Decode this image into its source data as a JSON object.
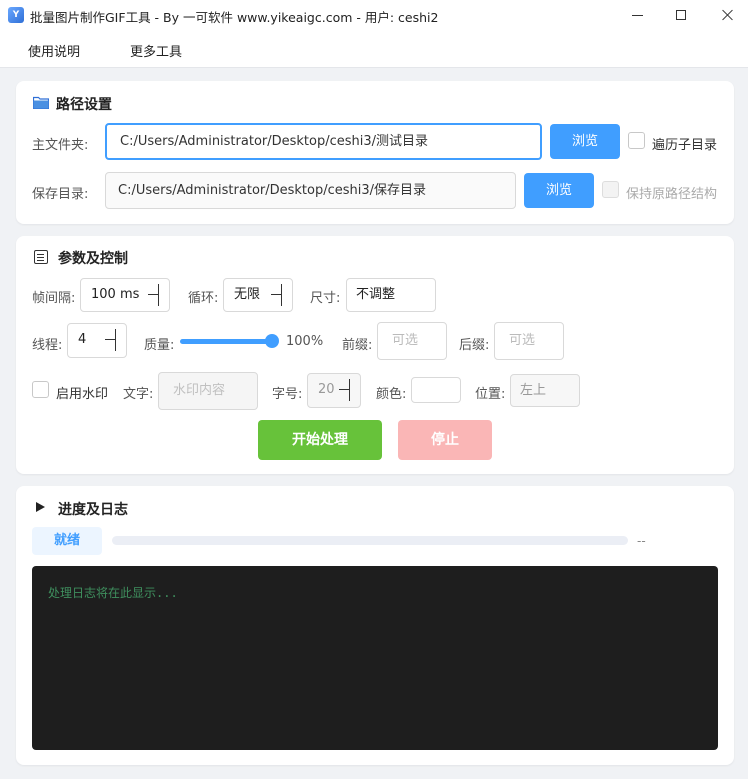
{
  "window": {
    "title": "批量图片制作GIF工具 - By 一可软件 www.yikeaigc.com - 用户: ceshi2",
    "app_icon_text": "Y"
  },
  "menu": {
    "items": [
      "使用说明",
      "更多工具"
    ]
  },
  "path_section": {
    "title": "路径设置",
    "main_folder_label": "主文件夹:",
    "main_folder_value": "C:/Users/Administrator/Desktop/ceshi3/测试目录",
    "browse_label": "浏览",
    "traverse_subdirs_label": "遍历子目录",
    "save_dir_label": "保存目录:",
    "save_dir_value": "C:/Users/Administrator/Desktop/ceshi3/保存目录",
    "browse2_label": "浏览",
    "keep_structure_label": "保持原路径结构"
  },
  "param_section": {
    "title": "参数及控制",
    "frame_interval_label": "帧间隔:",
    "frame_interval_value": "100 ms",
    "loop_label": "循环:",
    "loop_value": "无限",
    "size_label": "尺寸:",
    "size_value": "不调整",
    "threads_label": "线程:",
    "threads_value": "4",
    "quality_label": "质量:",
    "quality_value": "100%",
    "quality_fraction": 1.0,
    "prefix_label": "前缀:",
    "prefix_placeholder": "可选",
    "suffix_label": "后缀:",
    "suffix_placeholder": "可选",
    "watermark_label": "启用水印",
    "text_label": "文字:",
    "text_placeholder": "水印内容",
    "font_size_label": "字号:",
    "font_size_value": "20",
    "color_label": "颜色:",
    "position_label": "位置:",
    "position_value": "左上",
    "start_label": "开始处理",
    "stop_label": "停止"
  },
  "log_section": {
    "title": "进度及日志",
    "status": "就绪",
    "progress_fraction": 0,
    "progress_text": "--",
    "log_placeholder": "处理日志将在此显示..."
  },
  "colors": {
    "primary": "#409eff",
    "success": "#67c23a",
    "danger_light": "#fab6b6",
    "log_bg": "#1e1e1e"
  }
}
